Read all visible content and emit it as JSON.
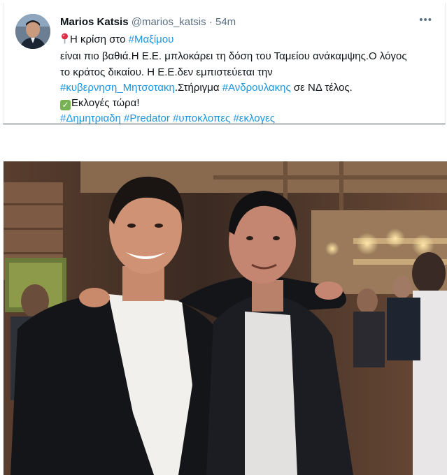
{
  "tweet": {
    "author_name": "Marios Katsis",
    "handle": "@marios_katsis",
    "separator": "·",
    "time": "54m",
    "more_icon": "more-horizontal-icon",
    "pin_icon": "round-pushpin-icon",
    "check_icon": "check-mark-button-icon",
    "lines": [
      {
        "text": "Η κρίση στο ",
        "hashtag": "#Μαξίμου"
      },
      {
        "text": "είναι πιο βαθιά.Η Ε.Ε. μπλοκάρει τη δόση του Ταμείου ανάκαμψης.Ο λόγος"
      },
      {
        "text": "το κράτος δικαίου. Η Ε.Ε.δεν εμπιστεύεται την"
      },
      {
        "hashtag": "#κυβερνηση_Μητσοτακη",
        "text": ".Στήριγμα ",
        "hashtag2": "#Ανδρουλακης",
        "text2": " σε ΝΔ τέλος."
      },
      {
        "text": "Εκλογές τώρα!"
      },
      {
        "hashtags": [
          "#Δημητριαδη",
          "#Predator",
          "#υποκλοπες",
          "#εκλογες"
        ]
      }
    ],
    "link_color": "#1b95e0",
    "text_color": "#0f1419",
    "secondary_color": "#5b7083"
  },
  "photo": {
    "subject": "photo-of-two-men-in-restaurant"
  }
}
